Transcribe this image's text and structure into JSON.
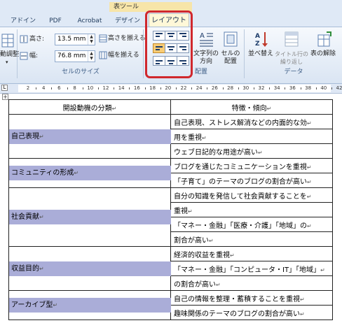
{
  "ribbon": {
    "context_label": "表ツール",
    "tabs": [
      "アドイン",
      "PDF",
      "Acrobat",
      "デザイン"
    ],
    "active_tab": "レイアウト",
    "cell_size": {
      "height_label": "高さ:",
      "height_value": "13.5 mm",
      "width_label": "幅:",
      "width_value": "76.8 mm",
      "equalize_height": "高さを揃える",
      "equalize_width": "幅を揃える",
      "group_label": "セルのサイズ"
    },
    "autofit_label": "動調整",
    "alignment": {
      "text_direction_label": "文字列の方向",
      "cell_margins_label": "セルの配置",
      "group_label": "配置"
    },
    "data": {
      "sort_label": "並べ替え",
      "repeat_header_label": "タイトル行の繰り返し",
      "convert_label": "表の解除",
      "group_label": "データ"
    }
  },
  "ruler": {
    "numbers": [
      "2",
      "4",
      "6",
      "8",
      "10",
      "12",
      "14",
      "16",
      "18",
      "20",
      "22",
      "24",
      "26",
      "28",
      "30",
      "32",
      "34",
      "36",
      "38",
      "40",
      "42"
    ]
  },
  "table": {
    "headers": [
      "開設動機の分類",
      "特徴・傾向"
    ],
    "mark": "↵",
    "groups": [
      {
        "category": "自己表現",
        "lines": [
          "自己表現、ストレス解消などの内面的な効",
          "用を重視",
          "ウェブ日記的な用途が高い"
        ]
      },
      {
        "category": "コミュニティの形成",
        "lines": [
          "ブログを通じたコミュニケーションを重視",
          "「子育て」のテーマのブログの割合が高い"
        ]
      },
      {
        "category": "社会貢献",
        "lines": [
          "自分の知識を発信して社会貢献することを",
          "重視",
          "「マネー・金融」「医療・介護」「地域」の",
          "割合が高い"
        ]
      },
      {
        "category": "収益目的",
        "lines": [
          "経済的収益を重視",
          "「マネー・金融」「コンピュータ・IT」「地域」",
          "の割合が高い"
        ]
      },
      {
        "category": "アーカイブ型",
        "lines": [
          "自己の情報を整理・蓄積することを重視",
          "趣味関係のテーマのブログの割合が高い"
        ]
      }
    ]
  }
}
